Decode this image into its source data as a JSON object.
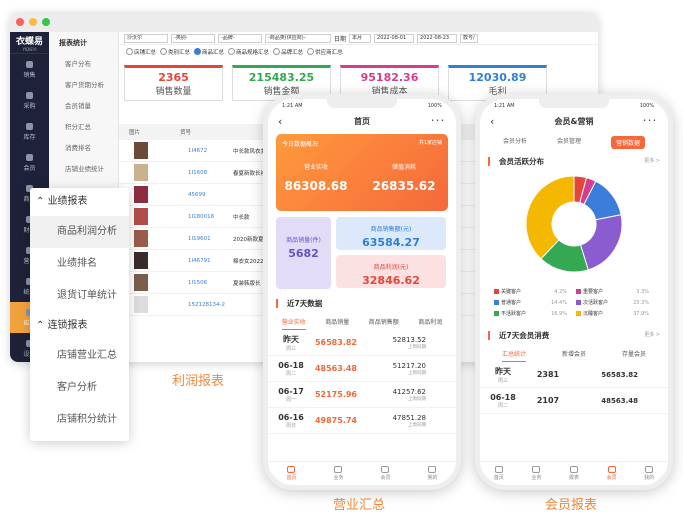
{
  "desktop": {
    "logo": "衣蝶易",
    "logo_sub": "YIDIEYI",
    "left_nav": [
      "销售",
      "采购",
      "库存",
      "会员",
      "商品",
      "财务",
      "营销",
      "统计",
      "应用",
      "设置"
    ],
    "sub_title": "报表统计",
    "sub_items": [
      "客户分布",
      "客户货期分析",
      "会员销量",
      "积分汇总",
      "消费排名",
      "店铺业绩统计"
    ],
    "filters": [
      "沙沃尔",
      "-类别-",
      "-品牌-",
      "-商品类(供应商)-",
      "日期",
      "本月",
      "2022-08-01",
      "2022-08-23",
      "款号/"
    ],
    "radios": [
      {
        "label": "店铺汇总",
        "on": false
      },
      {
        "label": "类别汇总",
        "on": false
      },
      {
        "label": "商品汇总",
        "on": true
      },
      {
        "label": "商品规格汇总",
        "on": false
      },
      {
        "label": "品牌汇总",
        "on": false
      },
      {
        "label": "供应商汇总",
        "on": false
      }
    ],
    "kpis": [
      {
        "value": "2365",
        "label": "销售数量",
        "color": "#e4463a"
      },
      {
        "value": "215483.25",
        "label": "销售金额",
        "color": "#34a853"
      },
      {
        "value": "95182.36",
        "label": "销售成本",
        "color": "#d63c8f"
      },
      {
        "value": "12030.89",
        "label": "毛利",
        "color": "#2f7fd6"
      }
    ],
    "table_head": [
      "图片",
      "货号"
    ],
    "rows": [
      {
        "code": "1I4672",
        "name": "中长款风衣女"
      },
      {
        "code": "1I1608",
        "name": "春夏新款长袖"
      },
      {
        "code": "45699",
        "name": ""
      },
      {
        "code": "1I180016",
        "name": "中长款"
      },
      {
        "code": "1I19601",
        "name": "2020新款夏装"
      },
      {
        "code": "1I46791",
        "name": "棉衣女2022"
      },
      {
        "code": "1I1506",
        "name": "夏装韩版长"
      },
      {
        "code": "152128134-2",
        "name": ""
      }
    ],
    "caption": "利润报表"
  },
  "menu": {
    "group1": "业绩报表",
    "items1": [
      "商品利润分析",
      "业绩排名",
      "退货订单统计"
    ],
    "group2": "连锁报表",
    "items2": [
      "店铺营业汇总",
      "客户分析",
      "店铺积分统计"
    ]
  },
  "phone1": {
    "time": "1:21 AM",
    "battery": "100%",
    "title": "首页",
    "card_title": "今日数据概况",
    "card_right": "共1家店铺",
    "l1": "营业实收",
    "v1": "86308.68",
    "l2": "储值消耗",
    "v2": "26835.62",
    "t1": "商品销量(件)",
    "tv1": "5682",
    "t2": "商品销售额(元)",
    "tv2": "63584.27",
    "t3": "商品利润(元)",
    "tv3": "32846.62",
    "sect": "近7天数据",
    "tabs": [
      "营业实收",
      "商品销量",
      "商品销售额",
      "商品利润"
    ],
    "rows": [
      {
        "d": "昨天",
        "w": "周三",
        "a": "56583.82",
        "b": "52813.52",
        "bs": "上周同期"
      },
      {
        "d": "06-18",
        "w": "周二",
        "a": "48563.48",
        "b": "51217.20",
        "bs": "上周同期"
      },
      {
        "d": "06-17",
        "w": "周一",
        "a": "52175.96",
        "b": "41257.62",
        "bs": "上周同期"
      },
      {
        "d": "06-16",
        "w": "周日",
        "a": "49875.74",
        "b": "47851.28",
        "bs": "上周同期"
      }
    ],
    "unit": "元",
    "tabbar": [
      "首页",
      "业务",
      "会员",
      "我的"
    ],
    "caption": "营业汇总"
  },
  "phone2": {
    "time": "1:21 AM",
    "battery": "100%",
    "title": "会员&营销",
    "pills": [
      "会员分析",
      "会员管理",
      "营销数据"
    ],
    "sect1": "会员活跃分布",
    "more": "更多 >",
    "legend": [
      {
        "name": "关键客户",
        "pct": "4.2%",
        "color": "#e4463a"
      },
      {
        "name": "重要客户",
        "pct": "3.3%",
        "color": "#d63c8f"
      },
      {
        "name": "普通客户",
        "pct": "14.4%",
        "color": "#3b7dd8"
      },
      {
        "name": "次活跃客户",
        "pct": "23.3%",
        "color": "#8a5cd0"
      },
      {
        "name": "不活跃客户",
        "pct": "16.9%",
        "color": "#34a853"
      },
      {
        "name": "沉睡客户",
        "pct": "37.9%",
        "color": "#f5b800"
      }
    ],
    "sect2": "近7天会员消费",
    "tabs": [
      "汇总统计",
      "新增会员",
      "存量会员"
    ],
    "rows": [
      {
        "d": "昨天",
        "w": "周三",
        "a": "2381",
        "b": "56583.82"
      },
      {
        "d": "06-18",
        "w": "周二",
        "a": "2107",
        "b": "48563.48"
      }
    ],
    "tabbar": [
      "首页",
      "业务",
      "报表",
      "会员",
      "我的"
    ],
    "caption": "会员报表"
  }
}
